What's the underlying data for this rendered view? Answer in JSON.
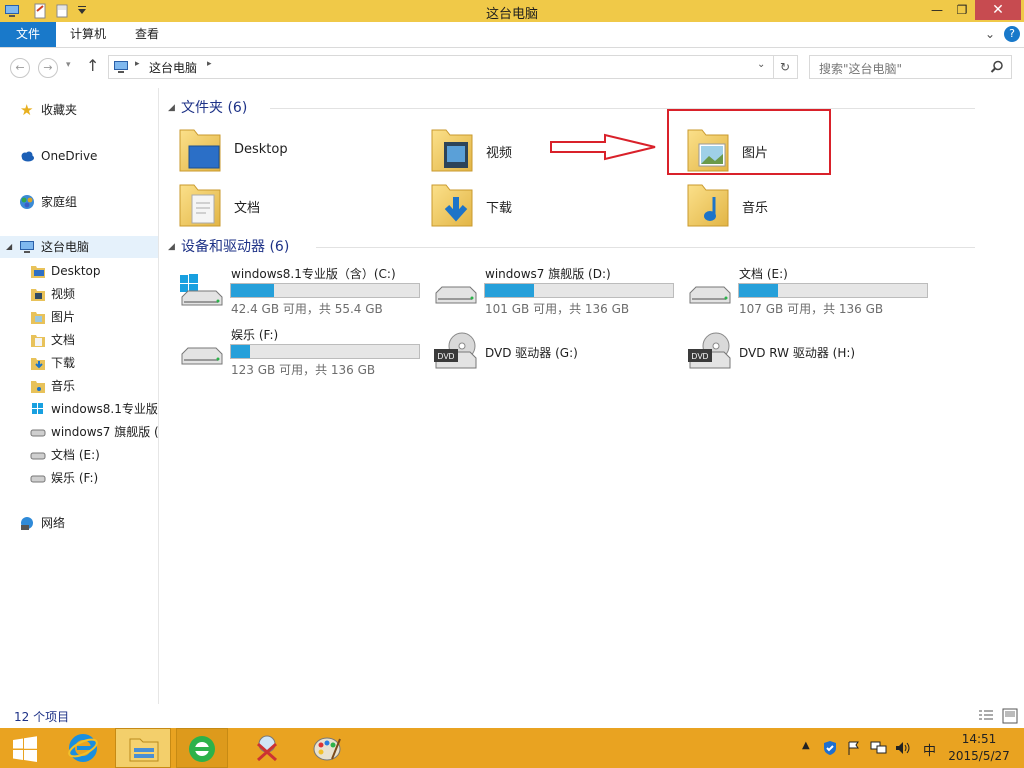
{
  "window": {
    "title": "这台电脑",
    "minimize": "—",
    "restore": "❐",
    "close": "✕"
  },
  "ribbon": {
    "tabs": [
      "文件",
      "计算机",
      "查看"
    ],
    "help": "?",
    "collapse": "⌄"
  },
  "address": {
    "path": "这台电脑",
    "search_placeholder": "搜索\"这台电脑\""
  },
  "nav": {
    "favorites": "收藏夹",
    "onedrive": "OneDrive",
    "homegroup": "家庭组",
    "thispc": "这台电脑",
    "children": [
      "Desktop",
      "视频",
      "图片",
      "文档",
      "下载",
      "音乐",
      "windows8.1专业版",
      "windows7 旗舰版 (",
      "文档 (E:)",
      "娱乐 (F:)"
    ],
    "network": "网络"
  },
  "folders": {
    "header": "文件夹 (6)",
    "items": [
      "Desktop",
      "视频",
      "图片",
      "文档",
      "下载",
      "音乐"
    ]
  },
  "devices": {
    "header": "设备和驱动器 (6)",
    "drives": [
      {
        "name": "windows8.1专业版（含）(C:)",
        "free": "42.4 GB 可用，共 55.4 GB",
        "used_fraction": 0.23
      },
      {
        "name": "windows7 旗舰版 (D:)",
        "free": "101 GB 可用，共 136 GB",
        "used_fraction": 0.26
      },
      {
        "name": "文档 (E:)",
        "free": "107 GB 可用，共 136 GB",
        "used_fraction": 0.21
      },
      {
        "name": "娱乐 (F:)",
        "free": "123 GB 可用，共 136 GB",
        "used_fraction": 0.1
      }
    ],
    "dvd": [
      {
        "name": "DVD 驱动器 (G:)",
        "badge": "DVD"
      },
      {
        "name": "DVD RW 驱动器 (H:)",
        "badge": "DVD"
      }
    ]
  },
  "status": {
    "items": "12 个项目"
  },
  "taskbar": {
    "time": "14:51",
    "date": "2015/5/27",
    "ime": "中"
  },
  "colors": {
    "titlebar": "#f0c948",
    "taskbar": "#e9a321",
    "accent": "#1979ca",
    "bar": "#26a0da",
    "highlight": "#d9212a"
  }
}
